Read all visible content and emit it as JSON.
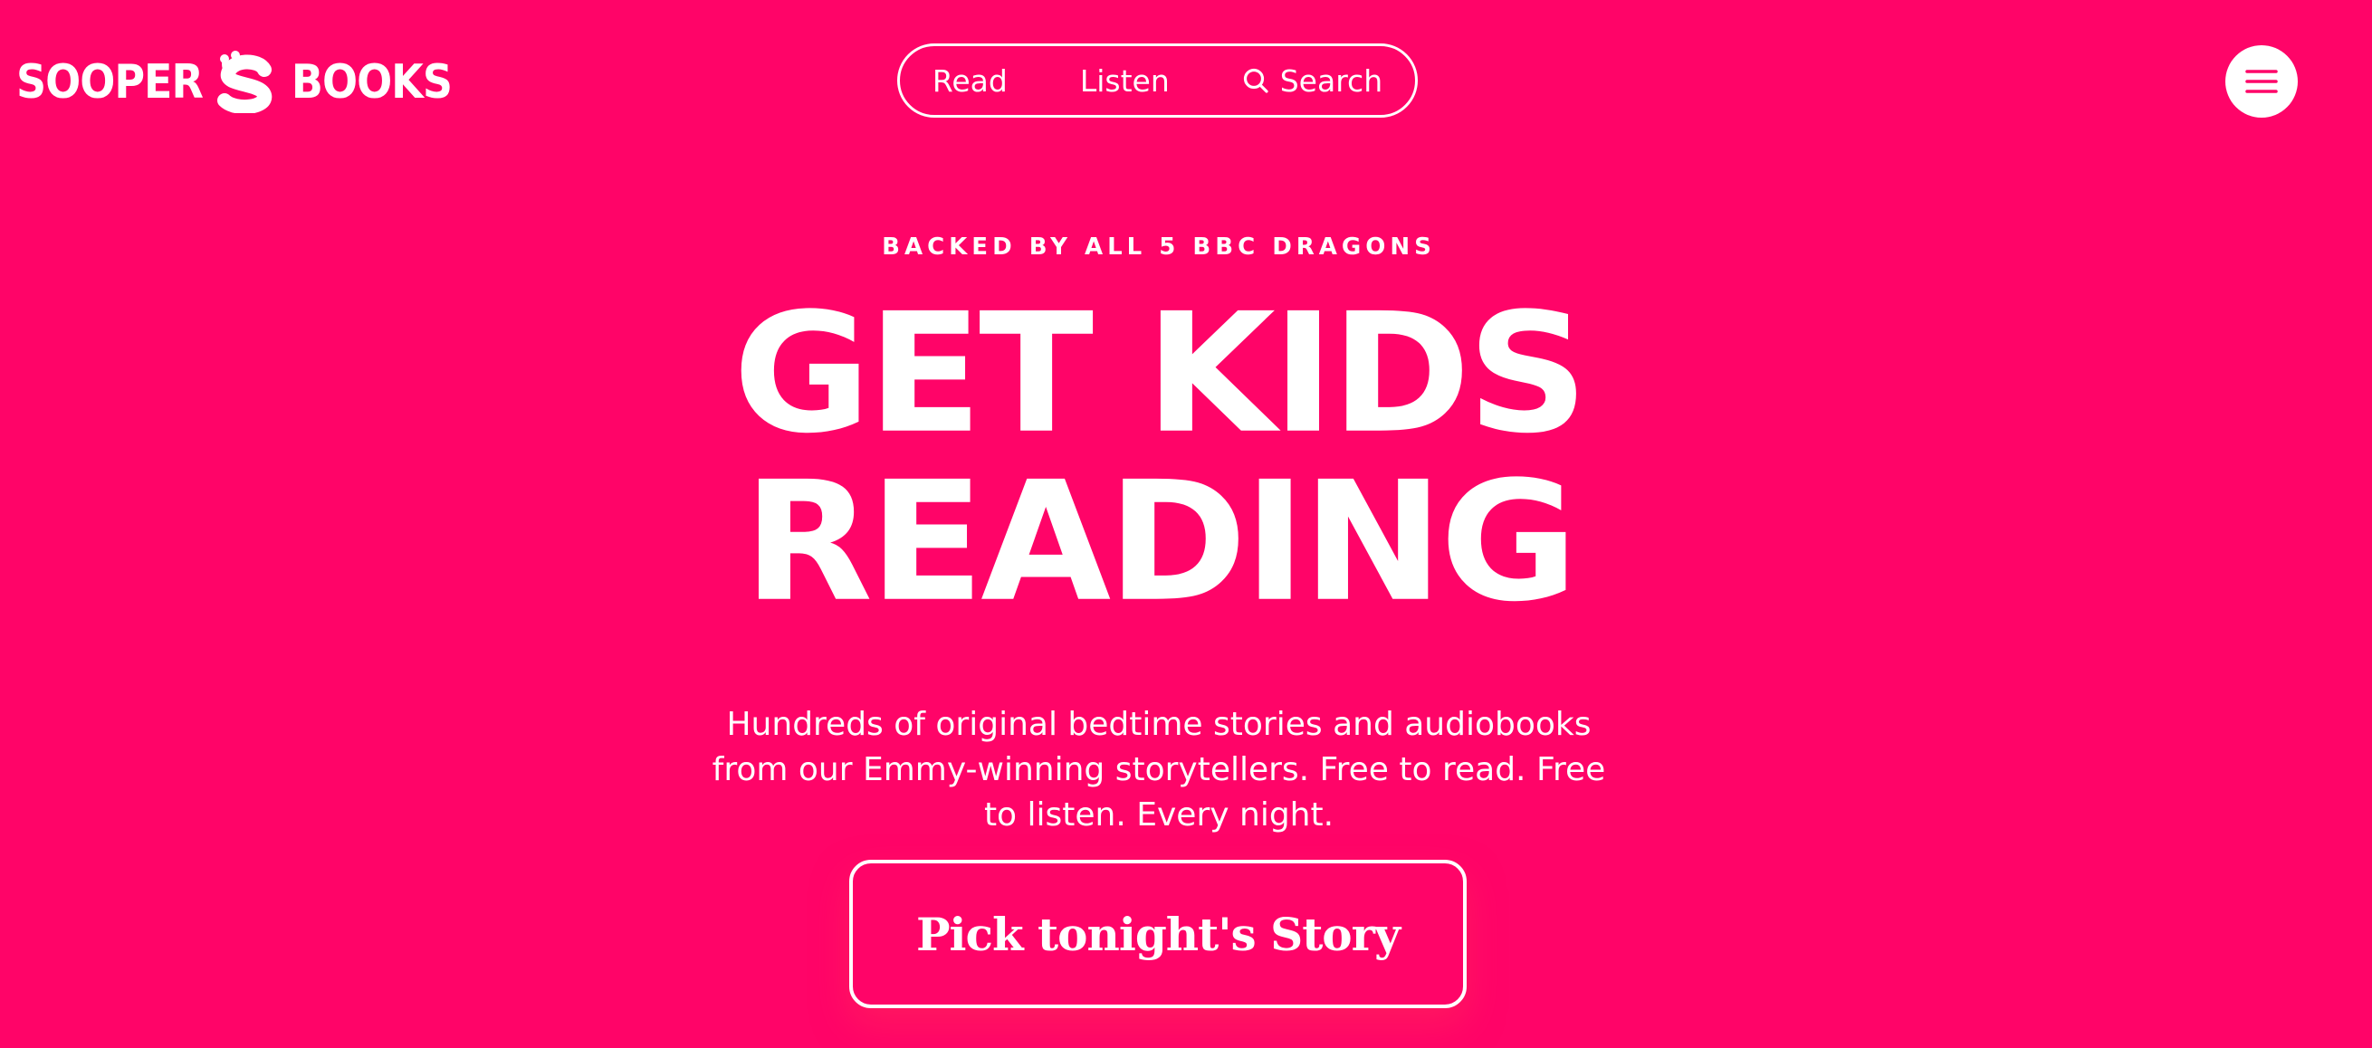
{
  "brand": {
    "name_left": "SOOPER",
    "name_right": "BOOKS",
    "logo_icon": "sooper-s-worm-icon",
    "background_color": "#ff0468",
    "foreground_color": "#ffffff"
  },
  "nav": {
    "items": [
      {
        "label": "Read"
      },
      {
        "label": "Listen"
      },
      {
        "label": "Search",
        "icon": "search-icon"
      }
    ]
  },
  "menu": {
    "icon": "hamburger-menu-icon"
  },
  "hero": {
    "eyebrow": "BACKED BY ALL 5 BBC DRAGONS",
    "headline_line1": "GET KIDS",
    "headline_line2": "READING",
    "subtitle": "Hundreds of original bedtime stories and audiobooks from our Emmy-winning storytellers. Free to read. Free to listen. Every night.",
    "cta_label": "Pick tonight's Story"
  }
}
